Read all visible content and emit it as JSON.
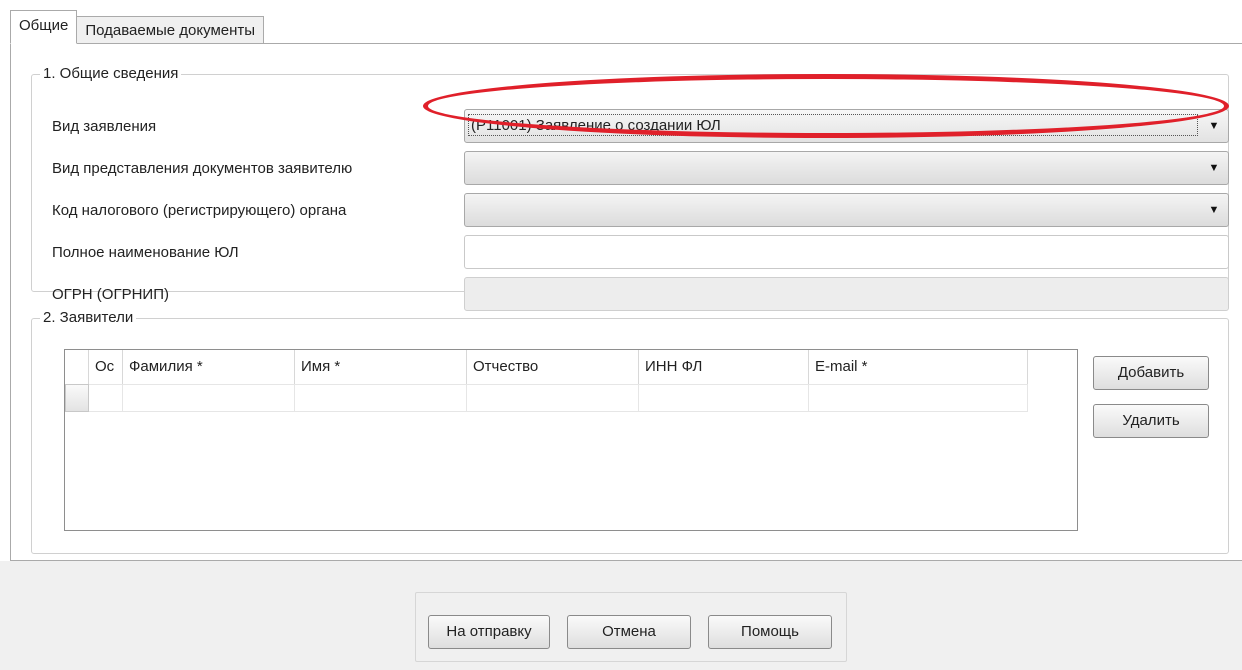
{
  "tabs": [
    {
      "label": "Общие",
      "active": true
    },
    {
      "label": "Подаваемые документы",
      "active": false
    }
  ],
  "section1": {
    "title": "1. Общие сведения",
    "rows": [
      {
        "label": "Вид заявления",
        "type": "combo",
        "value": "(Р11001) Заявление о создании ЮЛ"
      },
      {
        "label": "Вид представления документов заявителю",
        "type": "combo",
        "value": ""
      },
      {
        "label": "Код налогового (регистрирующего) органа",
        "type": "combo",
        "value": ""
      },
      {
        "label": "Полное наименование ЮЛ",
        "type": "text",
        "value": ""
      },
      {
        "label": "ОГРН (ОГРНИП)",
        "type": "text-disabled",
        "value": ""
      }
    ]
  },
  "section2": {
    "title": "2. Заявители",
    "table": {
      "columns": [
        "Ос",
        "Фамилия *",
        "Имя *",
        "Отчество",
        "ИНН ФЛ",
        "E-mail *"
      ],
      "rows": [
        [
          "",
          "",
          "",
          "",
          "",
          ""
        ]
      ]
    },
    "add_label": "Добавить",
    "delete_label": "Удалить"
  },
  "footer": {
    "send_label": "На отправку",
    "cancel_label": "Отмена",
    "help_label": "Помощь"
  },
  "colors": {
    "highlight": "#e0202a",
    "footer_bg": "#f0f0f0"
  },
  "icons": {
    "dropdown": "chevron-down-icon"
  }
}
